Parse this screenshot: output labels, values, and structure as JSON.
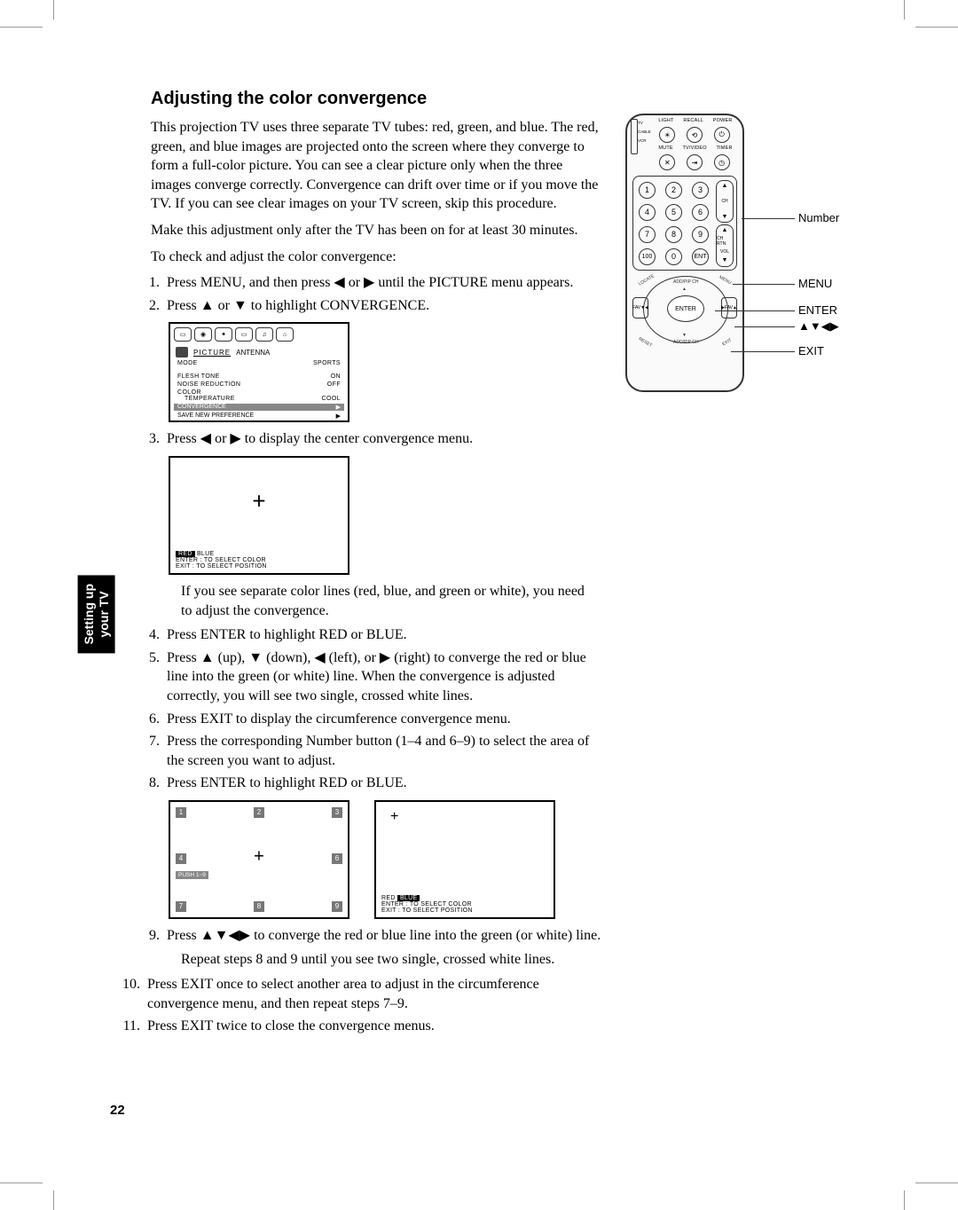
{
  "heading": "Adjusting the color convergence",
  "intro": {
    "p1": "This projection TV uses three separate TV tubes: red, green, and blue. The red, green, and blue images are projected onto the screen where they converge to form a full-color picture. You can see a clear picture only when the three images converge correctly. Convergence can drift over time or if you move the TV. If you can see clear images on your TV screen, skip this procedure.",
    "p2": "Make this adjustment only after the TV has been on for at least 30 minutes.",
    "p3": "To check and adjust the color convergence:"
  },
  "steps": {
    "s1": "Press MENU, and then press ◀ or ▶ until the PICTURE menu appears.",
    "s2": "Press ▲ or ▼ to highlight CONVERGENCE.",
    "s3": "Press ◀ or ▶ to display the center convergence menu.",
    "s3_note": "If you see separate color lines (red, blue, and green or white), you need to adjust the convergence.",
    "s4": "Press ENTER to highlight RED or BLUE.",
    "s5": "Press ▲ (up), ▼ (down), ◀ (left), or ▶ (right) to converge the red or blue line into the green (or white) line. When the convergence is adjusted correctly, you will see two single, crossed white lines.",
    "s6": "Press EXIT to display the circumference convergence menu.",
    "s7": "Press the corresponding Number button (1–4 and 6–9) to select the area of the screen you want to adjust.",
    "s8": "Press ENTER to highlight RED or BLUE.",
    "s9": "Press ▲▼◀▶ to converge the red or blue line into the green (or white) line.",
    "s9_note": "Repeat steps 8 and 9 until you see two single, crossed white lines.",
    "s10": "Press EXIT once to select another area to adjust in the circumference convergence menu, and then repeat steps 7–9.",
    "s11": "Press EXIT twice to close the convergence menus."
  },
  "remote": {
    "row1_labels": [
      "LIGHT",
      "RECALL",
      "POWER"
    ],
    "row2_labels": [
      "MUTE",
      "TV/VIDEO",
      "TIMER"
    ],
    "slider_labels": [
      "TV",
      "CABLE",
      "VCR"
    ],
    "numbers": [
      "1",
      "2",
      "3",
      "4",
      "5",
      "6",
      "7",
      "8",
      "9",
      "100",
      "0",
      "ENT"
    ],
    "rocker_top": {
      "up": "▲",
      "mid": "CH",
      "down": "▼"
    },
    "rocker_bot": {
      "up": "▲",
      "mid_top": "CH RTN",
      "mid_bot": "VOL",
      "down": "▼"
    },
    "ring_top": "ADD/PIP CH",
    "ring_bottom": "ADD/PIP CH",
    "ring_left_corner": "LOCATE",
    "ring_right_corner": "MENU",
    "ring_bl_corner": "RESET",
    "ring_br_corner": "EXIT",
    "enter_btn": "ENTER",
    "fav_left": "FAV▼",
    "fav_right": "FAV▲"
  },
  "callouts": {
    "number": "Number",
    "menu": "MENU",
    "enter": "ENTER",
    "arrows": "▲▼◀▶",
    "exit": "EXIT"
  },
  "osd1": {
    "title": "PICTURE",
    "title2": "ANTENNA",
    "mode": "MODE",
    "mode_val": "SPORTS",
    "r1": "FLESH  TONE",
    "r1v": "ON",
    "r2": "NOISE  REDUCTION",
    "r2v": "OFF",
    "r3": "COLOR",
    "r3b": "TEMPERATURE",
    "r3v": "COOL",
    "hl": "CONVERGENCE",
    "bottom": "SAVE  NEW    PREFERENCE"
  },
  "osd2": {
    "red_label": "RED",
    "blue_label": "BLUE",
    "line1": "ENTER : TO  SELECT  COLOR",
    "line2": "EXIT    : TO  SELECT  POSITION"
  },
  "osd3": {
    "push": "PUSH  1~9",
    "nums": [
      "1",
      "2",
      "3",
      "4",
      "6",
      "7",
      "8",
      "9"
    ]
  },
  "osd4": {
    "red_label": "RED",
    "blue_label": "BLUE",
    "line1": "ENTER : TO  SELECT  COLOR",
    "line2": "EXIT    : TO  SELECT  POSITION"
  },
  "sidebar": {
    "line1": "Setting up",
    "line2": "your TV"
  },
  "page_number": "22"
}
